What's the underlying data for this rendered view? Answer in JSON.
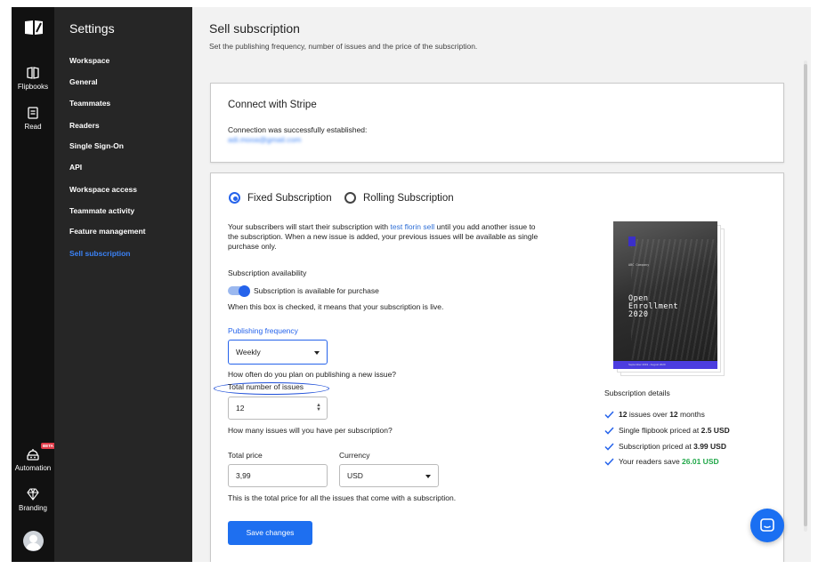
{
  "rail": {
    "items": [
      {
        "label": "Flipbooks",
        "icon": "book-icon"
      },
      {
        "label": "Read",
        "icon": "reader-icon"
      },
      {
        "label": "Automation",
        "icon": "robot-icon",
        "badge": "BETA"
      },
      {
        "label": "Branding",
        "icon": "diamond-icon"
      }
    ]
  },
  "nav": {
    "title": "Settings",
    "items": [
      {
        "label": "Workspace"
      },
      {
        "label": "General"
      },
      {
        "label": "Teammates"
      },
      {
        "label": "Readers"
      },
      {
        "label": "Single Sign-On"
      },
      {
        "label": "API"
      },
      {
        "label": "Workspace access"
      },
      {
        "label": "Teammate activity"
      },
      {
        "label": "Feature management"
      },
      {
        "label": "Sell subscription",
        "active": true
      }
    ]
  },
  "header": {
    "title": "Sell subscription",
    "subtitle": "Set the publishing frequency, number of issues and the price of the subscription."
  },
  "stripe": {
    "title": "Connect with Stripe",
    "status": "Connection was successfully established:",
    "email": "adi.mooa@gmail.com"
  },
  "subscription": {
    "type_options": [
      {
        "label": "Fixed Subscription",
        "checked": true
      },
      {
        "label": "Rolling Subscription",
        "checked": false
      }
    ],
    "desc_before": "Your subscribers will start their subscription with ",
    "desc_link": "test florin sell",
    "desc_after": " until you add another issue to the subscription. When a new issue is added, your previous issues will be available as single purchase only.",
    "availability_label": "Subscription availability",
    "availability_toggle": "Subscription is available for purchase",
    "availability_hint": "When this box is checked, it means that your subscription is live.",
    "frequency_label": "Publishing frequency",
    "frequency_value": "Weekly",
    "frequency_hint": "How often do you plan on publishing a new issue?",
    "issues_label": "Total number of issues",
    "issues_value": "12",
    "issues_hint": "How many issues will you have per subscription?",
    "price_label": "Total price",
    "price_value": "3,99",
    "currency_label": "Currency",
    "currency_value": "USD",
    "price_hint": "This is the total price for all the issues that come with a subscription.",
    "save_label": "Save changes"
  },
  "cover": {
    "small_text": "ABC Company",
    "title": "Open Enrollment 2020",
    "band_text": "September 2019 - August 2020"
  },
  "details": {
    "title": "Subscription details",
    "row1": {
      "n1": "12",
      "mid": " issues over ",
      "n2": "12",
      "end": " months"
    },
    "row2": {
      "pre": "Single flipbook priced at ",
      "val": "2.5 USD"
    },
    "row3": {
      "pre": "Subscription priced at ",
      "val": "3.99 USD"
    },
    "row4": {
      "pre": "Your readers save ",
      "val": "26.01 USD"
    }
  },
  "colors": {
    "accent": "#2563eb",
    "sidebar": "#262626",
    "rail": "#111111",
    "savings": "#22a84a"
  }
}
